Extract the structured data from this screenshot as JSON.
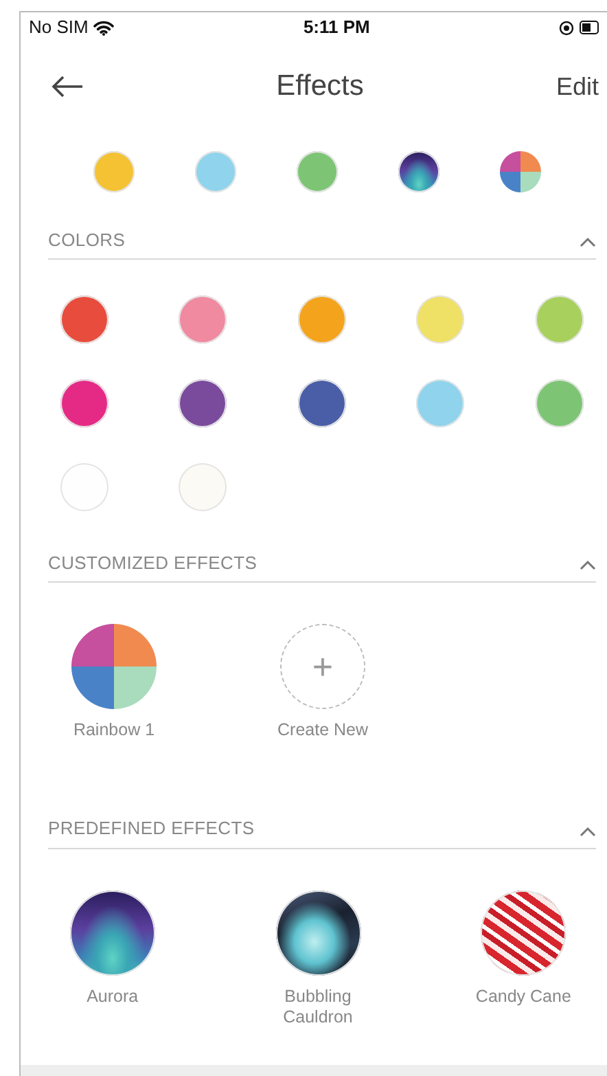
{
  "status_bar": {
    "carrier": "No SIM",
    "time": "5:11 PM"
  },
  "header": {
    "title": "Effects",
    "action": "Edit"
  },
  "recent": [
    {
      "kind": "color",
      "color": "#f4c232"
    },
    {
      "kind": "color",
      "color": "#8fd3ec"
    },
    {
      "kind": "color",
      "color": "#7dc574"
    },
    {
      "kind": "aurora"
    },
    {
      "kind": "rainbow"
    }
  ],
  "sections": [
    {
      "kind": "colors",
      "title": "COLORS",
      "expanded": true,
      "items": [
        {
          "color": "#e84c3d"
        },
        {
          "color": "#ef8aa0"
        },
        {
          "color": "#f4a41c"
        },
        {
          "color": "#efe066"
        },
        {
          "color": "#a8d05c"
        },
        {
          "color": "#e52a86"
        },
        {
          "color": "#7a4b9c"
        },
        {
          "color": "#4a5ea8"
        },
        {
          "color": "#8fd3ec"
        },
        {
          "color": "#7dc574"
        },
        {
          "color": "#fefefe"
        },
        {
          "color": "#fcfaf4"
        }
      ]
    },
    {
      "kind": "effects",
      "title": "CUSTOMIZED EFFECTS",
      "expanded": true,
      "items": [
        {
          "kind": "rainbow",
          "label": "Rainbow 1"
        },
        {
          "kind": "create",
          "label": "Create New",
          "symbol": "+"
        }
      ]
    },
    {
      "kind": "effects",
      "title": "PREDEFINED EFFECTS",
      "expanded": true,
      "items": [
        {
          "kind": "aurora",
          "label": "Aurora"
        },
        {
          "kind": "cauldron",
          "label": "Bubbling Cauldron"
        },
        {
          "kind": "candycane",
          "label": "Candy Cane"
        }
      ]
    }
  ]
}
